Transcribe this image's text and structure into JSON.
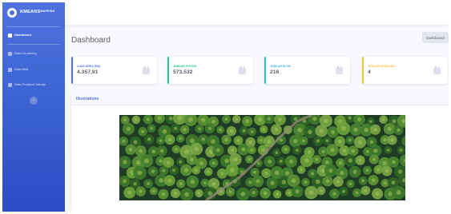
{
  "brand": {
    "name": "KMEANS",
    "sup": "MAPPING"
  },
  "sidebar": {
    "items": [
      {
        "label": "Dashboard",
        "icon": "dashboard-icon",
        "active": true
      },
      {
        "label": "Data Clustering",
        "icon": "table-icon",
        "active": false
      },
      {
        "label": "Data Bibit",
        "icon": "table-icon",
        "active": false
      },
      {
        "label": "Data Produksi Nabaty",
        "icon": "table-icon",
        "active": false
      }
    ],
    "toggle_glyph": "‹"
  },
  "header": {
    "title": "Dashboard",
    "breadcrumb": "Dashboard"
  },
  "cards": [
    {
      "label": "LUAS AREA (HA)",
      "value": "4.357,91",
      "color": "#4e73df",
      "icon": "calendar-icon"
    },
    {
      "label": "JUMLAH POHON",
      "value": "573.532",
      "color": "#1cc88a",
      "icon": "calendar-icon"
    },
    {
      "label": "JUMLAH BLOK",
      "value": "216",
      "color": "#36b9cc",
      "icon": "calendar-icon"
    },
    {
      "label": "JUMLAH AFDELING",
      "value": "4",
      "color": "#f6c23e",
      "icon": "calendar-icon"
    }
  ],
  "illustration": {
    "title": "Illustrations"
  },
  "colors": {
    "primary": "#4e73df",
    "success": "#1cc88a",
    "info": "#36b9cc",
    "warning": "#f6c23e",
    "text": "#5a5c69"
  }
}
